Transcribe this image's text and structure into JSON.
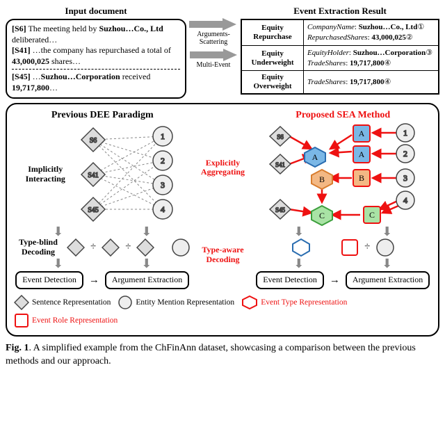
{
  "input": {
    "title": "Input document",
    "s6": {
      "tag": "[S6]",
      "pre": "  The meeting held by ",
      "co": "Suzhou…Co., Ltd",
      "post": " deliberated…"
    },
    "s41": {
      "tag": "[S41]",
      "pre": " …the company has repurchased a total of ",
      "num": "43,000,025",
      "post": " shares…"
    },
    "s45": {
      "tag": "[S45]",
      "pre": " …",
      "co": "Suzhou…Corporation",
      "mid": " received ",
      "num": "19,717,800",
      "post": "…"
    }
  },
  "arrows": {
    "a1": "Arguments-Scattering",
    "a2": "Multi-Event"
  },
  "result": {
    "title": "Event Extraction Result",
    "rows": [
      {
        "type": "Equity Repurchase",
        "lines": [
          {
            "role": "CompanyName",
            "val": "Suzhou…Co., Ltd",
            "circ": "①"
          },
          {
            "role": "RepurchasedShares",
            "val": "43,000,025",
            "circ": "②"
          }
        ]
      },
      {
        "type": "Equity Underweight",
        "lines": [
          {
            "role": "EquityHolder",
            "val": "Suzhou…Corporation",
            "circ": "③"
          },
          {
            "role": "TradeShares",
            "val": "19,717,800",
            "circ": "④"
          }
        ]
      },
      {
        "type": "Equity Overweight",
        "lines": [
          {
            "role": "TradeShares",
            "val": "19,717,800",
            "circ": "④"
          }
        ]
      }
    ]
  },
  "paradigms": {
    "prev_title": "Previous DEE Paradigm",
    "prop_title": "Proposed SEA Method",
    "implicit": "Implicitly Interacting",
    "typeblind": "Type-blind Decoding",
    "explicit": "Explicitly Aggregating",
    "typeaware": "Type-aware Decoding",
    "nodes_s": [
      "S6",
      "S41",
      "S45"
    ],
    "nodes_n": [
      "1",
      "2",
      "3",
      "4"
    ],
    "nodes_abc": [
      "A",
      "B",
      "C"
    ],
    "ev_det": "Event Detection",
    "arg_ext": "Argument Extraction"
  },
  "legend": {
    "sent": "Sentence Representation",
    "ent": "Entity Mention Representation",
    "etype": "Event Type Representation",
    "erole": "Event Role Representation"
  },
  "caption": {
    "fignum": "Fig. 1",
    "text": ".  A simplified example from the ChFinAnn dataset, showcasing a comparison between the previous methods and our approach."
  }
}
